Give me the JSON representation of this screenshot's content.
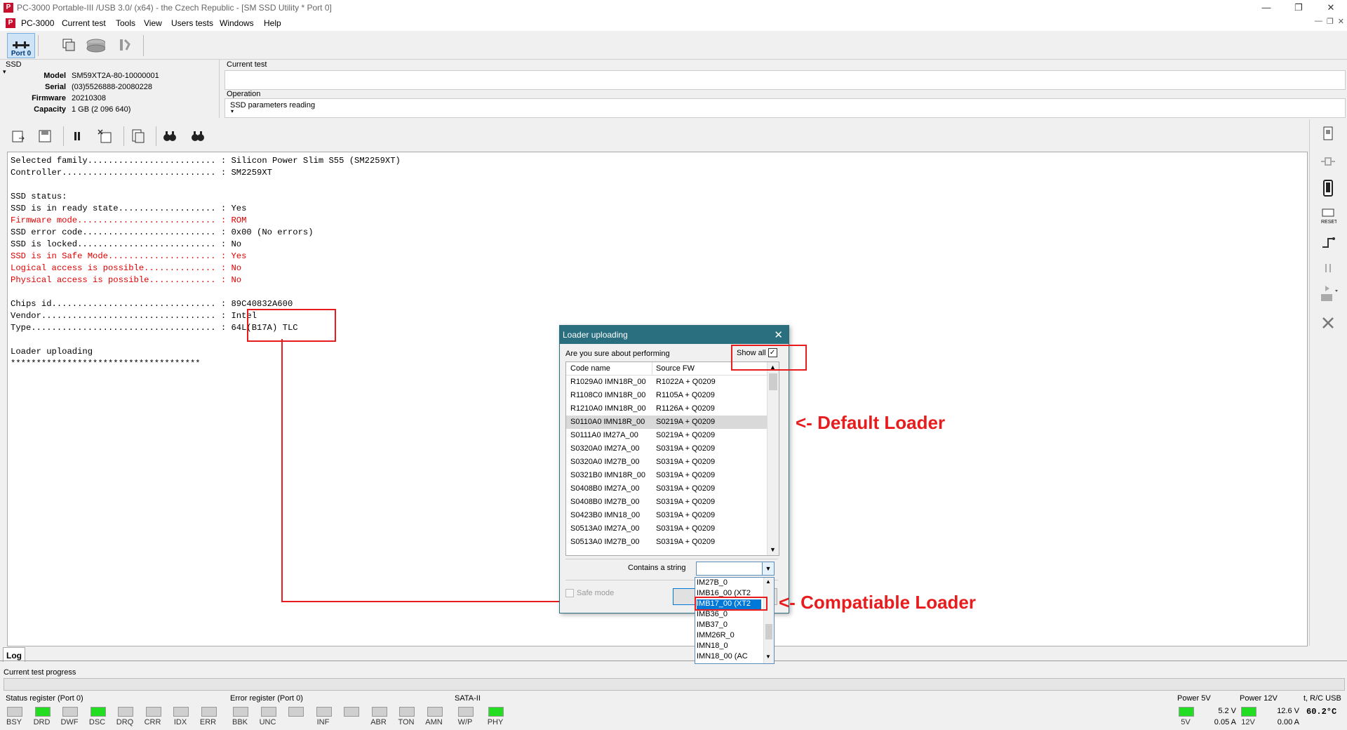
{
  "window": {
    "title": "PC-3000 Portable-III /USB 3.0/ (x64) - the Czech Republic - [SM SSD Utility * Port 0]",
    "controls": [
      "—",
      "❐",
      "✕"
    ]
  },
  "menu": {
    "items": [
      "PC-3000",
      "Current test",
      "Tools",
      "View",
      "Users tests",
      "Windows",
      "Help"
    ],
    "mdi_controls": [
      "—",
      "❐",
      "✕"
    ]
  },
  "toolbar": {
    "port_label": "Port 0"
  },
  "device": {
    "section_label": "SSD",
    "fields": [
      {
        "label": "Model",
        "value": "SM59XT2A-80-10000001"
      },
      {
        "label": "Serial",
        "value": "(03)5526888-20080228"
      },
      {
        "label": "Firmware",
        "value": "20210308"
      },
      {
        "label": "Capacity",
        "value": "1 GB (2 096 640)"
      }
    ]
  },
  "current_test": {
    "label": "Current test",
    "value": ""
  },
  "operation": {
    "label": "Operation",
    "value": "SSD parameters reading"
  },
  "log": {
    "lines": [
      {
        "text": "Selected family......................... : Silicon Power Slim S55 (SM2259XT)",
        "red": false
      },
      {
        "text": "Controller.............................. : SM2259XT",
        "red": false
      },
      {
        "text": "",
        "red": false
      },
      {
        "text": "SSD status:",
        "red": false
      },
      {
        "text": "SSD is in ready state................... : Yes",
        "red": false
      },
      {
        "text": "Firmware mode........................... : ROM",
        "red": true
      },
      {
        "text": "SSD error code.......................... : 0x00 (No errors)",
        "red": false
      },
      {
        "text": "SSD is locked........................... : No",
        "red": false
      },
      {
        "text": "SSD is in Safe Mode..................... : Yes",
        "red": true
      },
      {
        "text": "Logical access is possible.............. : No",
        "red": true
      },
      {
        "text": "Physical access is possible............. : No",
        "red": true
      },
      {
        "text": "",
        "red": false
      },
      {
        "text": "Chips id................................ : 89C40832A600",
        "red": false
      },
      {
        "text": "Vendor.................................. : Intel",
        "red": false
      },
      {
        "text": "Type.................................... : 64L(B17A) TLC",
        "red": false
      },
      {
        "text": "",
        "red": false
      },
      {
        "text": "Loader uploading",
        "red": false
      },
      {
        "text": "*************************************",
        "red": false
      }
    ]
  },
  "log_tab": "Log",
  "progress_label": "Current test progress",
  "dialog": {
    "title": "Loader uploading",
    "question": "Are you sure about performing",
    "show_all_label": "Show all",
    "columns": [
      "Code name",
      "Source FW"
    ],
    "rows": [
      {
        "code": "R1029A0 IMN18R_00",
        "fw": "R1022A + Q0209"
      },
      {
        "code": "R1108C0 IMN18R_00",
        "fw": "R1105A + Q0209"
      },
      {
        "code": "R1210A0 IMN18R_00",
        "fw": "R1126A + Q0209"
      },
      {
        "code": "S0110A0 IMN18R_00",
        "fw": "S0219A + Q0209"
      },
      {
        "code": "S0111A0 IM27A_00",
        "fw": "S0219A + Q0209"
      },
      {
        "code": "S0320A0 IM27A_00",
        "fw": "S0319A + Q0209"
      },
      {
        "code": "S0320A0 IM27B_00",
        "fw": "S0319A + Q0209"
      },
      {
        "code": "S0321B0 IMN18R_00",
        "fw": "S0319A + Q0209"
      },
      {
        "code": "S0408B0 IM27A_00",
        "fw": "S0319A + Q0209"
      },
      {
        "code": "S0408B0 IM27B_00",
        "fw": "S0319A + Q0209"
      },
      {
        "code": "S0423B0 IMN18_00",
        "fw": "S0319A + Q0209"
      },
      {
        "code": "S0513A0 IM27A_00",
        "fw": "S0319A + Q0209"
      },
      {
        "code": "S0513A0 IM27B_00",
        "fw": "S0319A + Q0209"
      }
    ],
    "selected_row": 3,
    "filter_label": "Contains a string",
    "filter_value": "",
    "safe_mode_label": "Safe mode",
    "dropdown_items": [
      "IM27B_0",
      "IMB16_00 (XT2",
      "IMB17_00 (XT2",
      "IMB36_0",
      "IMB37_0",
      "IMM26R_0",
      "IMN18_0",
      "IMN18_00 (AC"
    ],
    "dropdown_selected": 2
  },
  "annotations": {
    "default_loader": "<- Default Loader",
    "compatible_loader": "<- Compatiable Loader"
  },
  "status": {
    "status_register_title": "Status register (Port 0)",
    "status_bits": [
      {
        "name": "BSY",
        "on": false
      },
      {
        "name": "DRD",
        "on": true
      },
      {
        "name": "DWF",
        "on": false
      },
      {
        "name": "DSC",
        "on": true
      },
      {
        "name": "DRQ",
        "on": false
      },
      {
        "name": "CRR",
        "on": false
      },
      {
        "name": "IDX",
        "on": false
      },
      {
        "name": "ERR",
        "on": false
      }
    ],
    "error_register_title": "Error register (Port 0)",
    "error_bits": [
      {
        "name": "BBK",
        "on": false
      },
      {
        "name": "UNC",
        "on": false
      },
      {
        "name": "",
        "on": false
      },
      {
        "name": "INF",
        "on": false
      },
      {
        "name": "",
        "on": false
      },
      {
        "name": "ABR",
        "on": false
      },
      {
        "name": "TON",
        "on": false
      },
      {
        "name": "AMN",
        "on": false
      }
    ],
    "sata_title": "SATA-II",
    "sata_bits": [
      {
        "name": "W/P",
        "on": false
      },
      {
        "name": "PHY",
        "on": true
      }
    ],
    "power5_title": "Power 5V",
    "power5_led": "5V",
    "power5_voltage": "5.2 V",
    "power5_current": "0.05 A",
    "power12_title": "Power 12V",
    "power12_led": "12V",
    "power12_voltage": "12.6 V",
    "power12_current": "0.00 A",
    "temp_title": "t, R/C USB",
    "temp_value": "60.2°C"
  },
  "colors": {
    "dialog_title_bg": "#2a6f7f",
    "annotation": "#e81c1c",
    "led_on": "#22dd22",
    "log_red": "#e00000",
    "selection": "#0078d7"
  }
}
